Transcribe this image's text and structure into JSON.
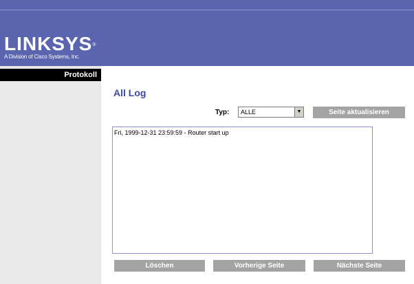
{
  "brand": {
    "logo": "LINKSYS",
    "registered_mark": "®",
    "tagline": "A Division of Cisco Systems, Inc."
  },
  "sidebar": {
    "section_label": "Protokoll"
  },
  "main": {
    "title": "All Log",
    "type_label": "Typ:",
    "type_select": {
      "selected": "ALLE",
      "arrow": "▼"
    },
    "refresh_button": "Seite aktualisieren",
    "log_entries": [
      "Fri, 1999-12-31 23:59:59 - Router start up"
    ],
    "buttons": {
      "delete": "Löschen",
      "previous_page": "Vorherige Seite",
      "next_page": "Nächste Seite"
    }
  },
  "colors": {
    "header_bg": "#5a64af",
    "title": "#3d49a8",
    "button_bg": "#a3a3a3",
    "sidebar_bg": "#e9e9eb"
  }
}
